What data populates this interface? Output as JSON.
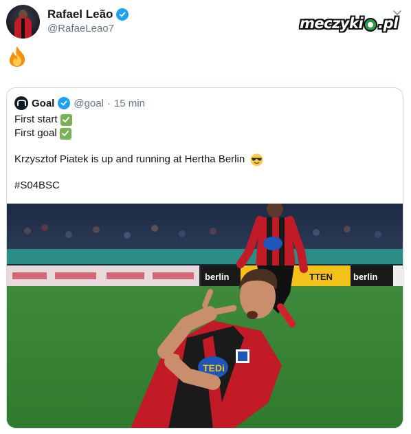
{
  "tweet": {
    "author": {
      "name": "Rafael Leão",
      "handle": "@RafaeLeao7",
      "verified": true
    },
    "text_emoji": "fire-emoji",
    "brand_watermark": "meczyki.pl",
    "menu_icon": "chevron-down-icon"
  },
  "quoted": {
    "author": {
      "name": "Goal",
      "handle": "@goal",
      "separator": "·",
      "time": "15 min",
      "verified": true
    },
    "lines": [
      {
        "text": "First start",
        "emoji": "check-mark-emoji"
      },
      {
        "text": "First goal",
        "emoji": "check-mark-emoji"
      }
    ],
    "sentence": "Krzysztof Piatek is up and running at Hertha Berlin",
    "sentence_emoji": "sunglasses-emoji",
    "hashtag": "#S04BSC",
    "photo": {
      "alt": "Football player celebrating a goal in red and black kit",
      "shirt_sponsor": "TEDi",
      "board_texts": [
        "berlin",
        "TTEN",
        "berlin"
      ]
    }
  },
  "colors": {
    "verified_blue": "#1da1f2",
    "secondary_text": "#657786",
    "border": "#ccd6dd",
    "check_green": "#77b255"
  }
}
